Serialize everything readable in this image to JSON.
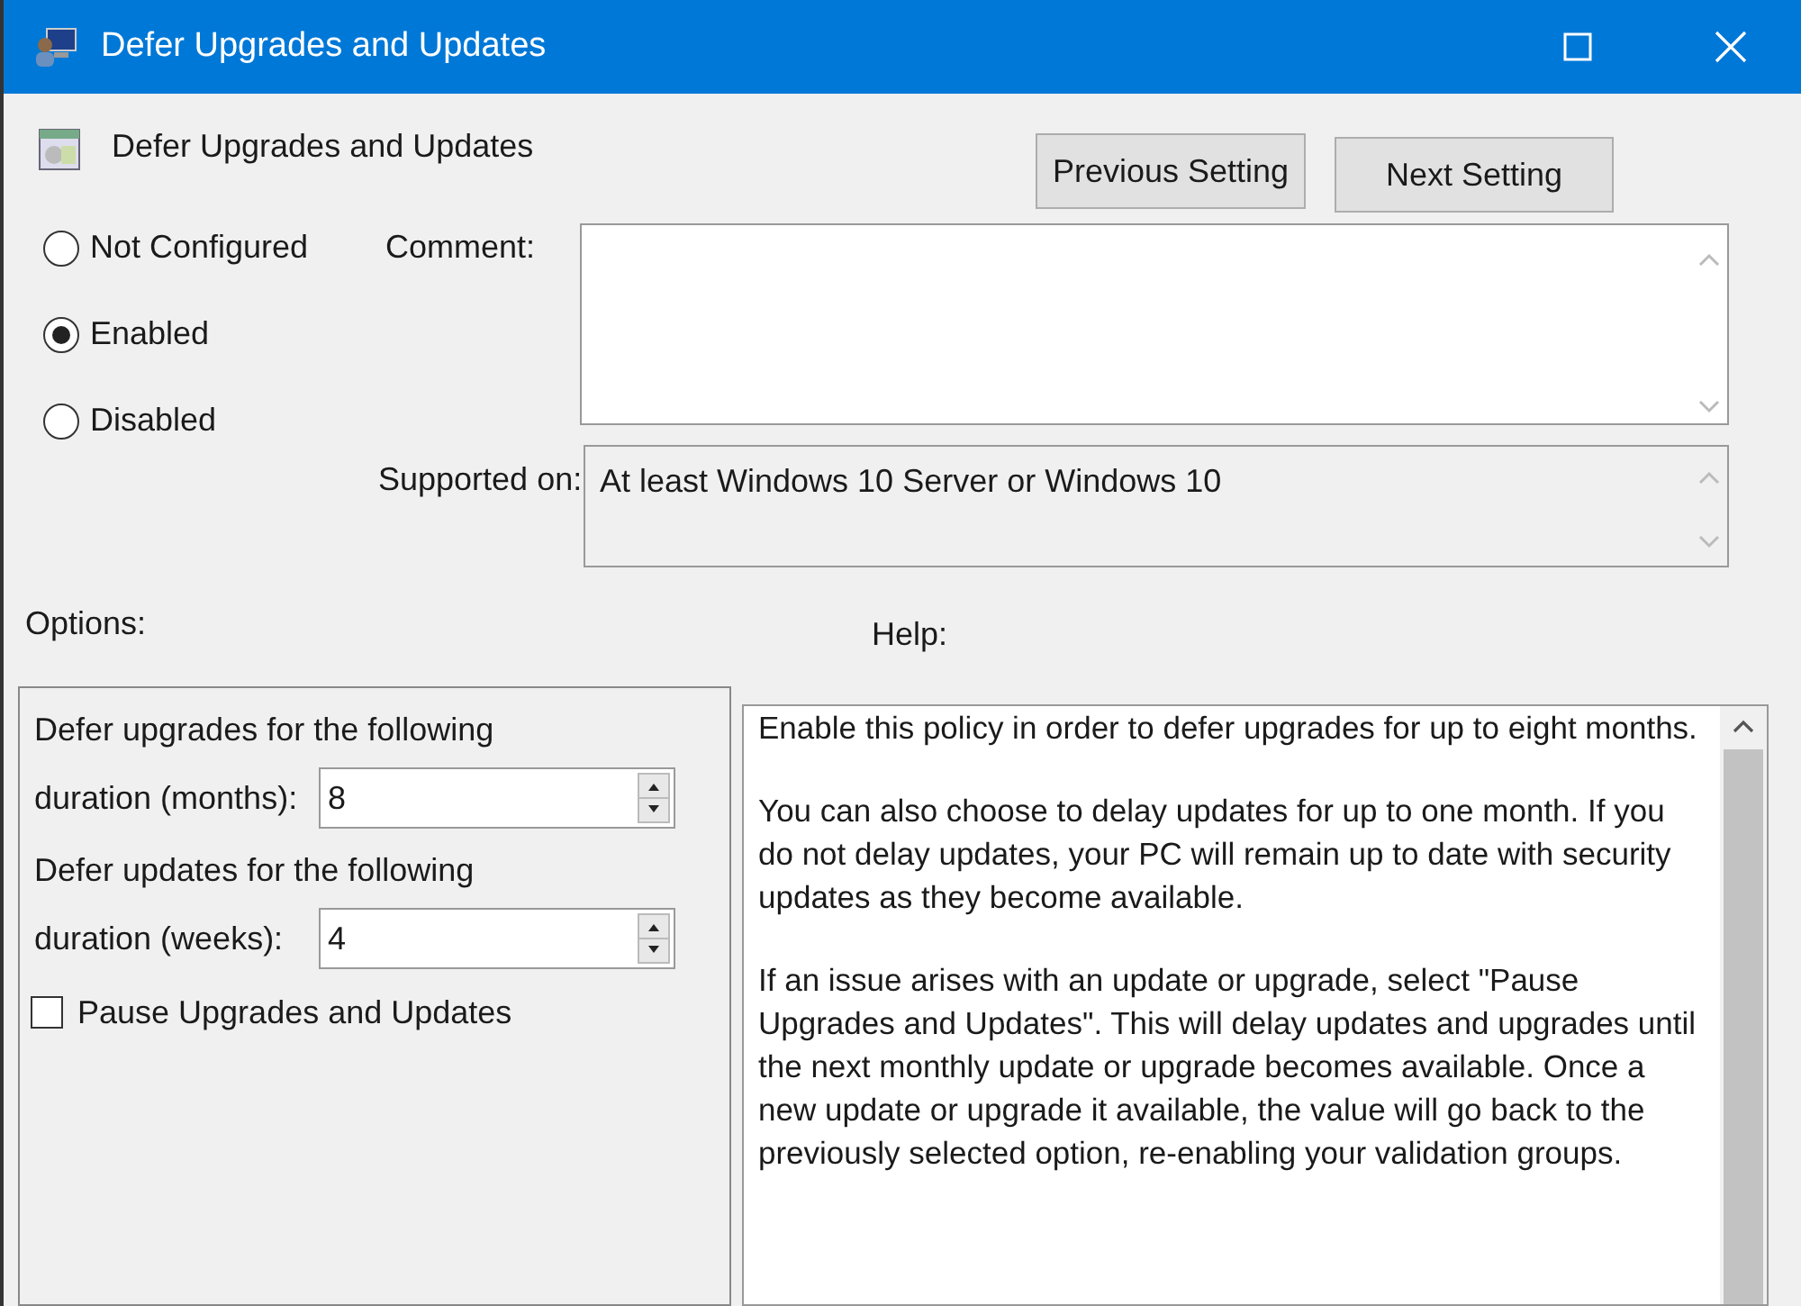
{
  "window": {
    "title": "Defer Upgrades and Updates"
  },
  "header": {
    "title": "Defer Upgrades and Updates"
  },
  "buttons": [
    {
      "label": "Previous Setting"
    },
    {
      "label": "Next Setting"
    }
  ],
  "state_options": [
    {
      "label": "Not Configured",
      "selected": false
    },
    {
      "label": "Enabled",
      "selected": true
    },
    {
      "label": "Disabled",
      "selected": false
    }
  ],
  "comment": {
    "label": "Comment:"
  },
  "supported_on": {
    "label": "Supported on:",
    "value": "At least Windows 10 Server or Windows 10"
  },
  "options": {
    "label": "Options:",
    "items": [
      {
        "kind": "label",
        "text": "Defer upgrades for the following"
      },
      {
        "kind": "spinner",
        "label": "duration (months):",
        "value": "8"
      },
      {
        "kind": "label",
        "text": "Defer updates for the following"
      },
      {
        "kind": "spinner",
        "label": "duration (weeks):",
        "value": "4"
      },
      {
        "kind": "checkbox",
        "label": "Pause Upgrades and Updates",
        "checked": false
      }
    ]
  },
  "help": {
    "label": "Help:",
    "paragraphs": [
      "Enable this policy in order to defer upgrades for up to eight months.",
      "You can also choose to delay updates for up to one month. If you do not delay updates, your PC will remain up to date with security updates as they become available.",
      "If an issue arises with an update or upgrade, select \"Pause Upgrades and Updates\". This will delay updates and upgrades until the next monthly update or upgrade becomes available. Once a new update or upgrade it available, the value will go back to the previously selected option, re-enabling your validation groups."
    ]
  }
}
